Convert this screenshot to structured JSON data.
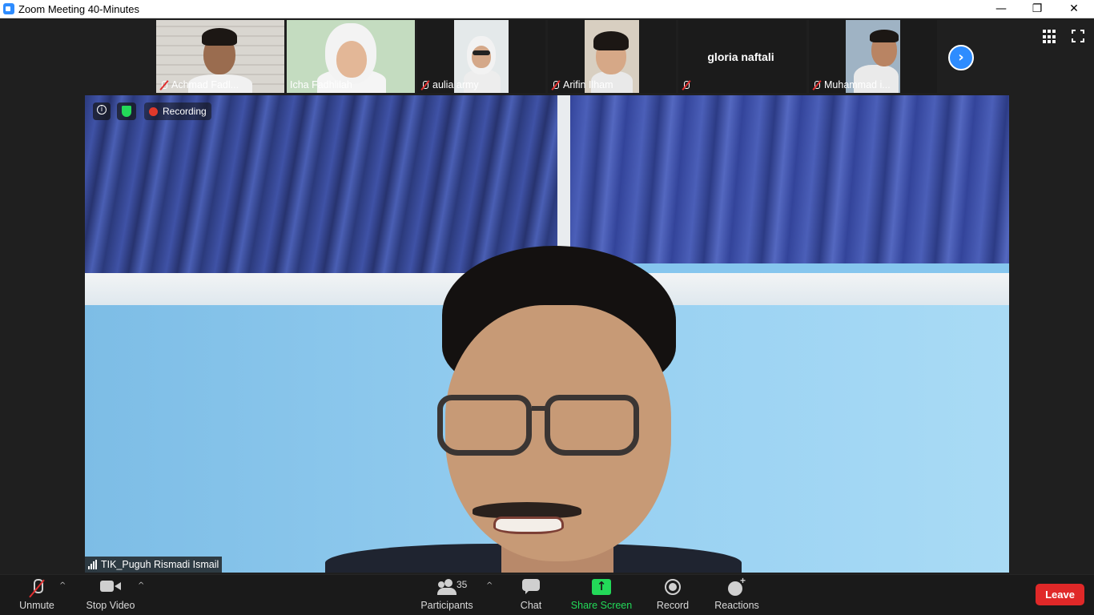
{
  "window": {
    "title": "Zoom Meeting 40-Minutes",
    "minimize_glyph": "—",
    "restore_glyph": "❐",
    "close_glyph": "✕"
  },
  "gallery": {
    "participants": [
      {
        "name": "Achmad Fadl...",
        "muted": true
      },
      {
        "name": "Icha Fadhlilah",
        "muted": false
      },
      {
        "name": "aulia army",
        "muted": true
      },
      {
        "name": "Arifin Ilham",
        "muted": true
      },
      {
        "name": "gloria naftali",
        "muted": true
      },
      {
        "name": "Muhammad i...",
        "muted": true
      }
    ],
    "next_glyph": "›"
  },
  "overlay": {
    "recording_label": "Recording"
  },
  "speaker": {
    "name": "TIK_Puguh Rismadi Ismail"
  },
  "toolbar": {
    "unmute": "Unmute",
    "stop_video": "Stop Video",
    "participants": "Participants",
    "participant_count": "35",
    "chat": "Chat",
    "share_screen": "Share Screen",
    "record": "Record",
    "reactions": "Reactions",
    "leave": "Leave",
    "caret": "^"
  },
  "colors": {
    "accent": "#2d8cff",
    "share_green": "#23d959",
    "leave_red": "#e02828",
    "muted_red": "#e02f2f"
  },
  "icons": [
    "zoom-app-icon",
    "mute-icon",
    "grid-view-icon",
    "fullscreen-icon",
    "info-icon",
    "shield-icon",
    "recording-dot-icon",
    "signal-icon",
    "microphone-muted-icon",
    "video-camera-icon",
    "participants-icon",
    "chat-icon",
    "share-screen-icon",
    "record-icon",
    "reactions-icon",
    "chevron-right-icon"
  ]
}
